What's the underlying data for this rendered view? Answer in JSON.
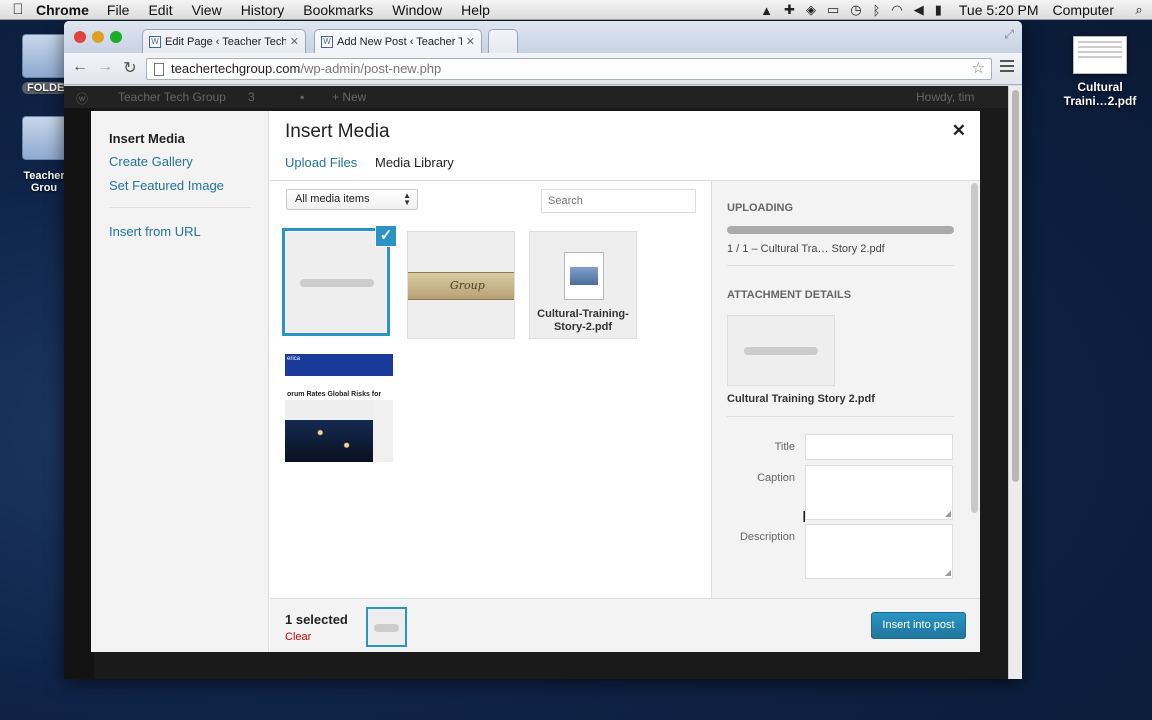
{
  "menubar": {
    "app_name": "Chrome",
    "items": [
      "File",
      "Edit",
      "View",
      "History",
      "Bookmarks",
      "Window",
      "Help"
    ],
    "clock": "Tue 5:20 PM",
    "user": "Computer"
  },
  "desktop": {
    "folder_top_label": "FOLDE",
    "folder_bottom_label_1": "Teacher",
    "folder_bottom_label_2": "Grou",
    "pdf_label_1": "Cultural",
    "pdf_label_2": "Traini…2.pdf"
  },
  "browser": {
    "tabs": [
      {
        "title": "Edit Page ‹ Teacher Tech G"
      },
      {
        "title": "Add New Post ‹ Teacher Te"
      }
    ],
    "url_host": "teachertechgroup.com",
    "url_path": "/wp-admin/post-new.php"
  },
  "wp_admin_bar": {
    "site": "Teacher Tech Group",
    "updates": "3",
    "new": "+ New",
    "howdy": "Howdy, tim"
  },
  "modal": {
    "sidebar": {
      "insert_media": "Insert Media",
      "create_gallery": "Create Gallery",
      "set_featured_image": "Set Featured Image",
      "insert_from_url": "Insert from URL"
    },
    "title": "Insert Media",
    "tabs": {
      "upload": "Upload Files",
      "library": "Media Library"
    },
    "filter_value": "All media items",
    "search_placeholder": "Search",
    "items": {
      "pdf_filename_1": "Cultural-Training-",
      "pdf_filename_2": "Story-2.pdf",
      "ruler_text": "Group",
      "web_header": "erica",
      "web_headline": "orum Rates Global Risks for"
    },
    "details": {
      "uploading_heading": "Uploading",
      "upload_progress": 1.0,
      "upload_status": "1 / 1  –  Cultural Tra… Story 2.pdf",
      "attachment_heading": "Attachment Details",
      "filename": "Cultural Training Story 2.pdf",
      "title_label": "Title",
      "caption_label": "Caption",
      "description_label": "Description"
    },
    "footer": {
      "selected": "1 selected",
      "clear": "Clear",
      "insert_button": "Insert into post"
    }
  },
  "colors": {
    "accent": "#2a95c5",
    "link": "#21759b",
    "clear": "#bc0b0b"
  }
}
